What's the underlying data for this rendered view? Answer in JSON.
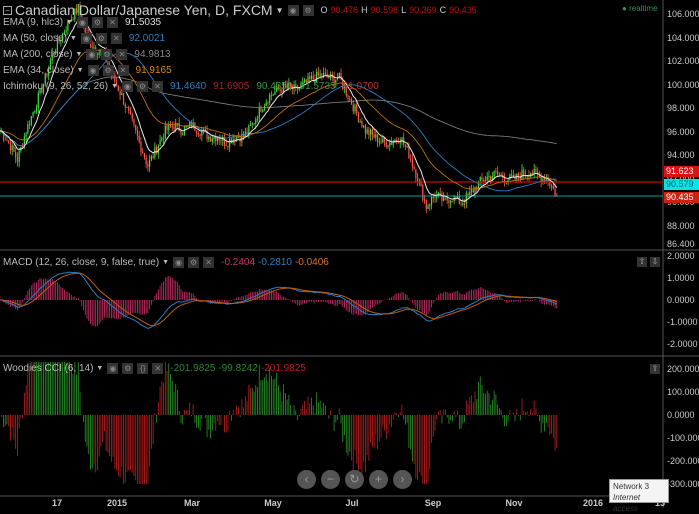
{
  "header": {
    "title": "Canadian Dollar/Japanese Yen, D, FXCM",
    "o_label": "O",
    "o": "90.476",
    "h_label": "H",
    "h": "90.598",
    "l_label": "L",
    "l": "90.369",
    "c_label": "C",
    "c": "90.435",
    "realtime": "realtime"
  },
  "indicators": [
    {
      "label": "EMA (9, hlc3)",
      "values": [
        "91.5035"
      ],
      "colors": [
        "#dddddd"
      ]
    },
    {
      "label": "MA (50, close)",
      "values": [
        "92.0021"
      ],
      "colors": [
        "#2a7fc0"
      ]
    },
    {
      "label": "MA (200, close)",
      "values": [
        "94.9813"
      ],
      "colors": [
        "#888888"
      ]
    },
    {
      "label": "EMA (34, close)",
      "values": [
        "91.9165"
      ],
      "colors": [
        "#e08a00"
      ]
    },
    {
      "label": "Ichimoku (9, 26, 52, 26)",
      "values": [
        "91.4640",
        "91.6905",
        "90.4350",
        "91.5733",
        "91.0700"
      ],
      "colors": [
        "#2a7fc0",
        "#b02020",
        "#3a9a3a",
        "#3a9a3a",
        "#c03030"
      ]
    }
  ],
  "macd": {
    "label": "MACD (12, 26, close, 9, false, true)",
    "values": [
      "-0.2404",
      "-0.2810",
      "-0.0406"
    ],
    "colors": [
      "#d0306a",
      "#2a7fc0",
      "#e07020"
    ]
  },
  "cci": {
    "label": "Woodies CCI (6, 14)",
    "values": [
      "-201.9825",
      "-99.8242",
      "-201.9825"
    ],
    "colors": [
      "#2a8a2a",
      "#2a8a2a",
      "#c02020"
    ]
  },
  "price_labels": [
    {
      "value": "91.623",
      "bg": "#e01010",
      "fg": "#ffffff"
    },
    {
      "value": "90.579",
      "bg": "#00e5e5",
      "fg": "#006060"
    },
    {
      "value": "90.435",
      "bg": "#d02010",
      "fg": "#ffffff"
    }
  ],
  "price_axis": [
    "106.000",
    "104.000",
    "102.000",
    "100.000",
    "98.000",
    "96.000",
    "94.000",
    "92.000",
    "90.000",
    "88.000",
    "86.400"
  ],
  "macd_axis": [
    "2.0000",
    "1.0000",
    "0.0000",
    "-1.0000",
    "-2.0000"
  ],
  "cci_axis": [
    "200.0000",
    "100.0000",
    "0.0000",
    "-100.0000",
    "-200.0000",
    "-300.0000"
  ],
  "time_axis": [
    "17",
    "2015",
    "Mar",
    "May",
    "Jul",
    "Sep",
    "Nov",
    "2016",
    "15"
  ],
  "nav": [
    "‹",
    "−",
    "↻",
    "+",
    "›"
  ],
  "tooltip": {
    "line1": "Network  3",
    "line2": "Internet access"
  },
  "chart_data": {
    "type": "candlestick",
    "title": "Canadian Dollar/Japanese Yen, D, FXCM",
    "interval": "weekly-sampled closes",
    "ylim": [
      86.4,
      107
    ],
    "closes": [
      96,
      95,
      93.5,
      96,
      98,
      100,
      102.5,
      104,
      105.5,
      106.5,
      104,
      103,
      102.5,
      100.5,
      99,
      97,
      95,
      93,
      94.5,
      96,
      96.5,
      96,
      96.5,
      96,
      95.5,
      95.5,
      95,
      95.5,
      95.5,
      96.5,
      98,
      99,
      99.5,
      99.8,
      99.5,
      100,
      100.5,
      100.8,
      100.5,
      100.5,
      99,
      97.5,
      96,
      95.5,
      95,
      95,
      95.5,
      94,
      92,
      89.5,
      90.5,
      90,
      90.3,
      89.8,
      90.5,
      91.5,
      92,
      92.3,
      92,
      91.8,
      92.3,
      92.5,
      92,
      91.8,
      90.4
    ],
    "lines": {
      "high_line": 91.623,
      "last_line": 90.435
    },
    "macd_ylim": [
      -2.4,
      2.2
    ],
    "cci_ylim": [
      -300,
      230
    ]
  }
}
